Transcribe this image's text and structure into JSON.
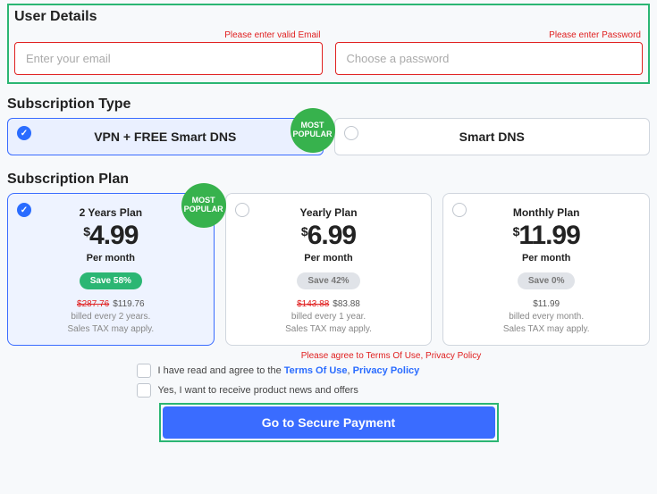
{
  "userDetails": {
    "title": "User Details",
    "emailError": "Please enter valid Email",
    "emailPlaceholder": "Enter your email",
    "passwordError": "Please enter Password",
    "passwordPlaceholder": "Choose a password"
  },
  "subType": {
    "title": "Subscription Type",
    "badge": "MOST POPULAR",
    "options": [
      {
        "label": "VPN + FREE Smart DNS",
        "selected": true
      },
      {
        "label": "Smart DNS",
        "selected": false
      }
    ]
  },
  "subPlan": {
    "title": "Subscription Plan",
    "badge": "MOST POPULAR",
    "perMonth": "Per month",
    "plans": [
      {
        "name": "2 Years Plan",
        "currency": "$",
        "price": "4.99",
        "save": "Save 58%",
        "saveStyle": "green",
        "oldPrice": "$287.76",
        "newPrice": "$119.76",
        "line1": "billed every 2 years.",
        "line2": "Sales TAX may apply.",
        "selected": true
      },
      {
        "name": "Yearly Plan",
        "currency": "$",
        "price": "6.99",
        "save": "Save 42%",
        "saveStyle": "gray",
        "oldPrice": "$143.88",
        "newPrice": "$83.88",
        "line1": "billed every 1 year.",
        "line2": "Sales TAX may apply.",
        "selected": false
      },
      {
        "name": "Monthly Plan",
        "currency": "$",
        "price": "11.99",
        "save": "Save 0%",
        "saveStyle": "gray",
        "oldPrice": "",
        "newPrice": "$11.99",
        "line1": "billed every month.",
        "line2": "Sales TAX may apply.",
        "selected": false
      }
    ]
  },
  "terms": {
    "error": "Please agree to Terms Of Use, Privacy Policy",
    "agreePrefix": "I have read and agree to the ",
    "termsLink": "Terms Of Use",
    "comma": ", ",
    "privacyLink": "Privacy Policy",
    "newsletter": "Yes, I want to receive product news and offers"
  },
  "cta": "Go to Secure Payment"
}
